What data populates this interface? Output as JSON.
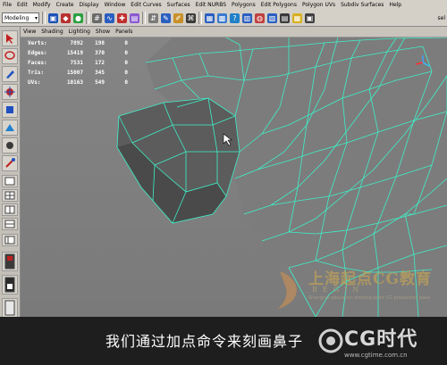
{
  "menus": [
    "File",
    "Edit",
    "Modify",
    "Create",
    "Display",
    "Window",
    "Edit Curves",
    "Surfaces",
    "Edit NURBS",
    "Polygons",
    "Edit Polygons",
    "Polygon UVs",
    "Subdiv Surfaces",
    "Help"
  ],
  "shelf": {
    "mode": "Modeling",
    "right_text": "sel"
  },
  "panel_menus": [
    "View",
    "Shading",
    "Lighting",
    "Show",
    "Panels"
  ],
  "hud": [
    {
      "label": "Verts:",
      "a": "7892",
      "b": "198",
      "c": "0"
    },
    {
      "label": "Edges:",
      "a": "15419",
      "b": "370",
      "c": "0"
    },
    {
      "label": "Faces:",
      "a": "7531",
      "b": "172",
      "c": "0"
    },
    {
      "label": "Tris:",
      "a": "15007",
      "b": "345",
      "c": "0"
    },
    {
      "label": "UVs:",
      "a": "10163",
      "b": "549",
      "c": "0"
    }
  ],
  "subtitle": "我们通过加点命令来刻画鼻子",
  "watermark": {
    "cn": "上海起点CG教育",
    "en": "BEGIN",
    "sub": "Shanghai education starting point CG production base"
  },
  "logo": {
    "text": "CG时代",
    "url": "www.cgtime.com.cn"
  },
  "colors": {
    "wire": "#3ef0c8",
    "viewport_bg": "#828282",
    "mesh_fill": "#5a5a5a"
  }
}
